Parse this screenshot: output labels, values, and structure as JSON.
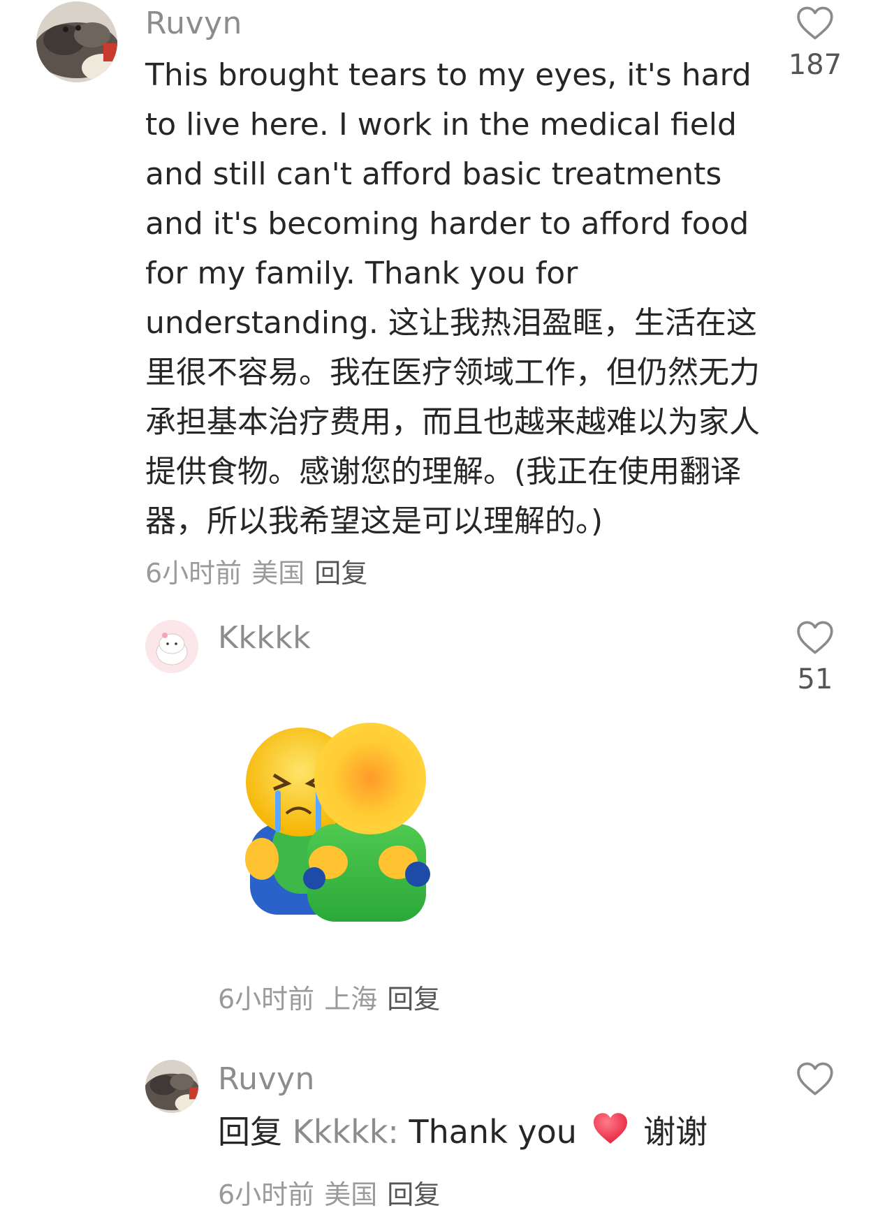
{
  "comments": [
    {
      "username": "Ruvyn",
      "text": "This brought tears to my eyes, it's hard to live here. I work in the medical field and still can't afford basic treatments and it's becoming harder to afford food for my family. Thank you for understanding. 这让我热泪盈眶，生活在这里很不容易。我在医疗领域工作，但仍然无力承担基本治疗费用，而且也越来越难以为家人提供食物。感谢您的理解。(我正在使用翻译器，所以我希望这是可以理解的。)",
      "time": "6小时前",
      "location": "美国",
      "reply_label": "回复",
      "likes": "187",
      "like_icon": "heart-outline-icon"
    },
    {
      "username": "Kkkkk",
      "sticker": "crying-hug-sticker",
      "time": "6小时前",
      "location": "上海",
      "reply_label": "回复",
      "likes": "51",
      "like_icon": "heart-outline-icon"
    },
    {
      "username": "Ruvyn",
      "reply_prefix": "回复",
      "reply_target": "Kkkkk",
      "reply_sep": ":",
      "text_before": "Thank you",
      "emoji": "red-heart",
      "text_after": "谢谢",
      "time": "6小时前",
      "location": "美国",
      "reply_label": "回复",
      "like_icon": "heart-outline-icon"
    }
  ],
  "colors": {
    "username": "#8c8c8c",
    "text": "#262626",
    "meta": "#9a9a9a",
    "heart": "#e8253c"
  }
}
